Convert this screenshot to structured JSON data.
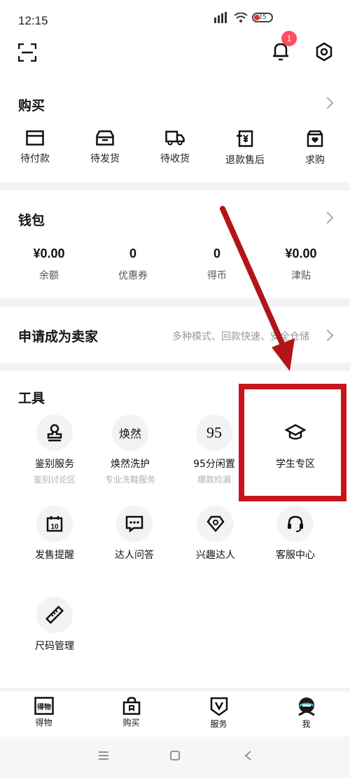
{
  "status_bar": {
    "time": "12:15",
    "battery": "25"
  },
  "header": {
    "notification_count": "1"
  },
  "buy": {
    "title": "购买",
    "items": [
      {
        "label": "待付款",
        "icon": "wallet-icon"
      },
      {
        "label": "待发货",
        "icon": "box-icon"
      },
      {
        "label": "待收货",
        "icon": "truck-icon"
      },
      {
        "label": "退款售后",
        "icon": "refund-icon"
      },
      {
        "label": "求购",
        "icon": "heart-bag-icon"
      }
    ]
  },
  "wallet": {
    "title": "钱包",
    "items": [
      {
        "value": "¥0.00",
        "label": "余额"
      },
      {
        "value": "0",
        "label": "优惠券"
      },
      {
        "value": "0",
        "label": "得币"
      },
      {
        "value": "¥0.00",
        "label": "津贴"
      }
    ]
  },
  "seller": {
    "title": "申请成为卖家",
    "hint": "多种模式、回款快速、安全仓储"
  },
  "tools": {
    "title": "工具",
    "items": [
      {
        "name": "鉴别服务",
        "sub": "鉴别讨论区",
        "icon": "stamp-icon"
      },
      {
        "name": "焕然洗护",
        "sub": "专业洗鞋服务",
        "icon_text": "焕然"
      },
      {
        "name": "95分闲置",
        "sub": "爆款捡漏",
        "icon_text": "95"
      },
      {
        "name": "学生专区",
        "sub": "",
        "icon": "graduation-cap-icon"
      },
      {
        "name": "发售提醒",
        "sub": "",
        "icon": "calendar-icon"
      },
      {
        "name": "达人问答",
        "sub": "",
        "icon": "chat-icon"
      },
      {
        "name": "兴趣达人",
        "sub": "",
        "icon": "diamond-icon"
      },
      {
        "name": "客服中心",
        "sub": "",
        "icon": "headset-icon"
      },
      {
        "name": "尺码管理",
        "sub": "",
        "icon": "ruler-icon"
      }
    ]
  },
  "tabbar": {
    "items": [
      {
        "label": "得物",
        "icon_text": "得物"
      },
      {
        "label": "购买",
        "icon": "bag-icon"
      },
      {
        "label": "服务",
        "icon": "shield-v-icon"
      },
      {
        "label": "我",
        "icon": "avatar-icon"
      }
    ]
  },
  "colors": {
    "highlight": "#c4161c",
    "badge": "#ff4d5e",
    "arrow": "#b3141a"
  }
}
